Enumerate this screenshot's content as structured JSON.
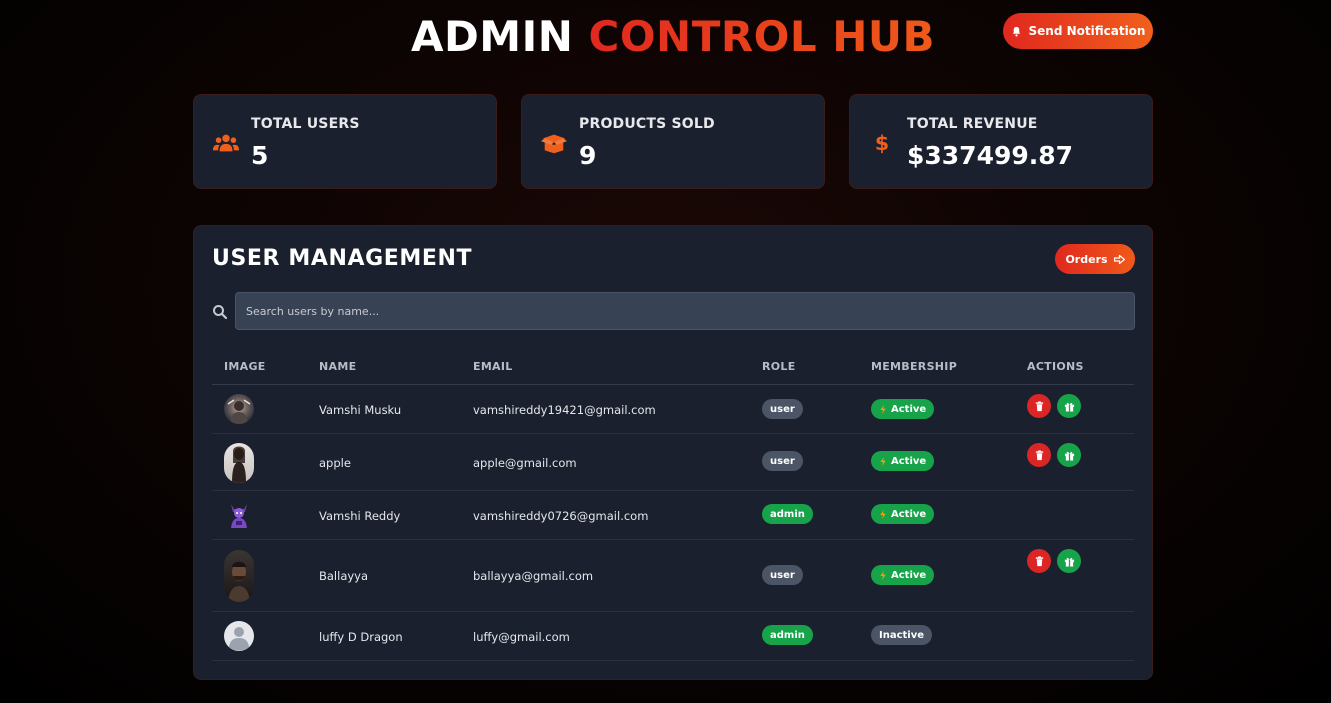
{
  "header": {
    "title_part1": "ADMIN",
    "title_part2": "CONTROL HUB",
    "notify_label": "Send Notification"
  },
  "stats": [
    {
      "label": "TOTAL USERS",
      "value": "5",
      "icon": "users-icon"
    },
    {
      "label": "PRODUCTS SOLD",
      "value": "9",
      "icon": "box-open-icon"
    },
    {
      "label": "TOTAL REVENUE",
      "value": "$337499.87",
      "icon": "dollar-icon"
    }
  ],
  "management": {
    "title": "USER MANAGEMENT",
    "orders_label": "Orders",
    "search_placeholder": "Search users by name...",
    "columns": [
      "IMAGE",
      "NAME",
      "EMAIL",
      "ROLE",
      "MEMBERSHIP",
      "ACTIONS"
    ],
    "rows": [
      {
        "name": "Vamshi Musku",
        "email": "vamshireddy19421@gmail.com",
        "role": "user",
        "membership": "Active",
        "actions": true
      },
      {
        "name": "apple",
        "email": "apple@gmail.com",
        "role": "user",
        "membership": "Active",
        "actions": true
      },
      {
        "name": "Vamshi Reddy",
        "email": "vamshireddy0726@gmail.com",
        "role": "admin",
        "membership": "Active",
        "actions": false
      },
      {
        "name": "Ballayya",
        "email": "ballayya@gmail.com",
        "role": "user",
        "membership": "Active",
        "actions": true
      },
      {
        "name": "luffy D Dragon",
        "email": "luffy@gmail.com",
        "role": "admin",
        "membership": "Inactive",
        "actions": false
      }
    ]
  },
  "colors": {
    "accent_red": "#e0281f",
    "accent_orange": "#f05a1a",
    "card_bg": "#1a202d",
    "success": "#16a34a",
    "danger": "#dc2626",
    "neutral_badge": "#4b5565"
  }
}
